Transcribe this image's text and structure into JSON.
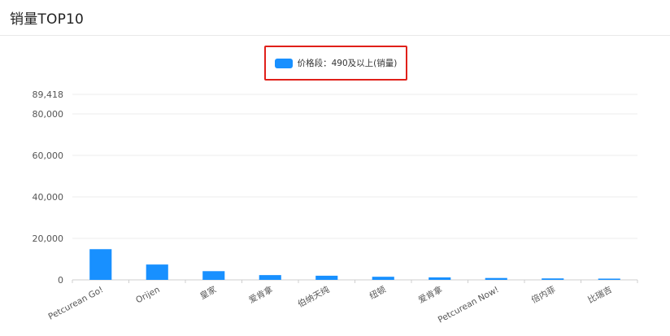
{
  "page": {
    "title": "销量TOP10"
  },
  "colors": {
    "bar": "#1890ff",
    "legend_border": "#e0201a"
  },
  "chart_data": {
    "type": "bar",
    "title": "销量TOP10",
    "categories": [
      "Petcurean Go!",
      "Orijen",
      "皇家",
      "爱肯拿",
      "伯纳天纯",
      "纽顿",
      "爱肯拿",
      "Petcurean Now!",
      "倍内菲",
      "比瑞吉"
    ],
    "series": [
      {
        "name": "价格段：490及以上(销量)",
        "values": [
          14800,
          7400,
          4200,
          2300,
          2000,
          1500,
          1200,
          900,
          700,
          600
        ]
      }
    ],
    "yticks": [
      0,
      20000,
      40000,
      60000,
      80000
    ],
    "ytick_labels": [
      "0",
      "20,000",
      "40,000",
      "60,000",
      "80,000"
    ],
    "ymax_label": "89,418",
    "ylim": [
      0,
      89418
    ],
    "grid": true,
    "legend_position": "top-center"
  }
}
